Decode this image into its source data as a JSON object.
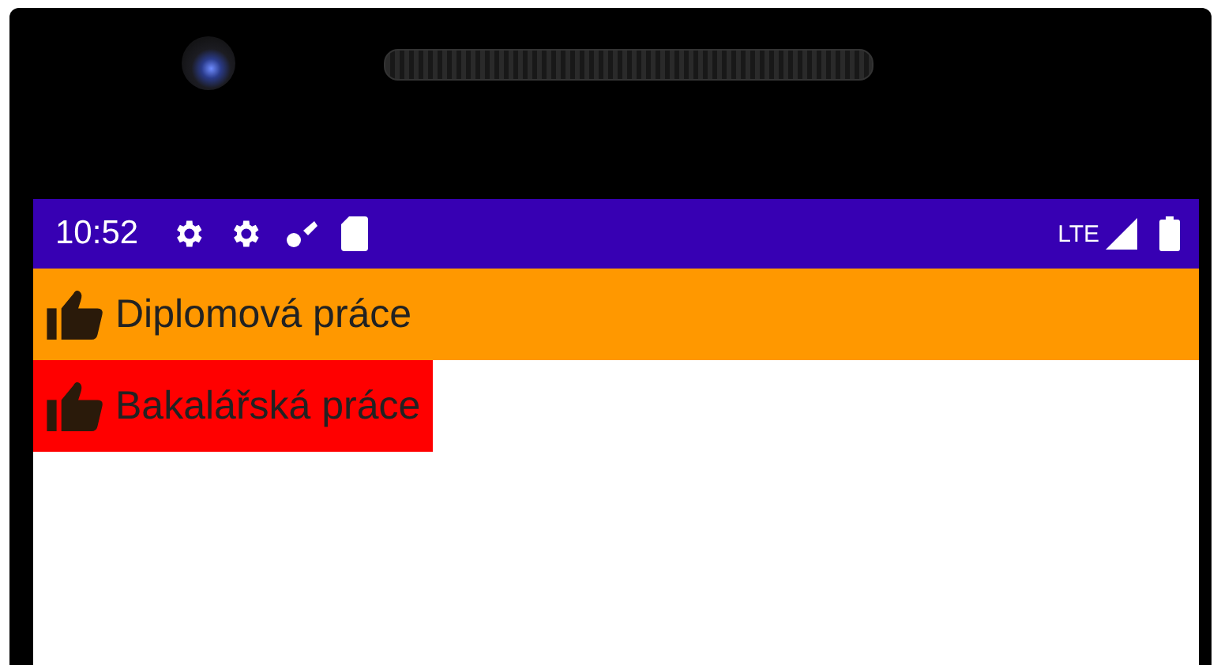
{
  "status_bar": {
    "time": "10:52",
    "network": "LTE"
  },
  "items": [
    {
      "label": "Diplomová práce",
      "color": "#ff9800",
      "kind": "stretched"
    },
    {
      "label": "Bakalářská práce",
      "color": "#ff0000",
      "kind": "compact"
    }
  ]
}
